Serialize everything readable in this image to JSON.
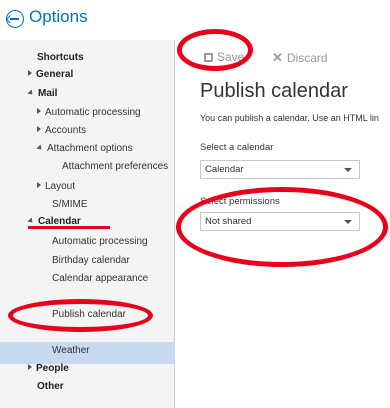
{
  "header": {
    "title": "Options"
  },
  "sidebar": {
    "shortcuts": "Shortcuts",
    "general": "General",
    "mail": "Mail",
    "mail_items": {
      "automatic_processing": "Automatic processing",
      "accounts": "Accounts",
      "attachment_options": "Attachment options",
      "attachment_preferences": "Attachment preferences",
      "layout": "Layout",
      "smime": "S/MIME"
    },
    "calendar": "Calendar",
    "calendar_items": {
      "automatic_processing": "Automatic processing",
      "birthday_calendar": "Birthday calendar",
      "calendar_appearance": "Calendar appearance",
      "publish_calendar": "Publish calendar",
      "weather": "Weather"
    },
    "people": "People",
    "other": "Other"
  },
  "toolbar": {
    "save_label": "Save",
    "discard_label": "Discard"
  },
  "main": {
    "title": "Publish calendar",
    "description": "You can publish a calendar. Use an HTML lin",
    "select_calendar_label": "Select a calendar",
    "select_calendar_value": "Calendar",
    "permissions_label": "Select permissions",
    "permissions_value": "Not shared"
  },
  "annotation_color": "#e8001c",
  "accent_color": "#0072c6"
}
